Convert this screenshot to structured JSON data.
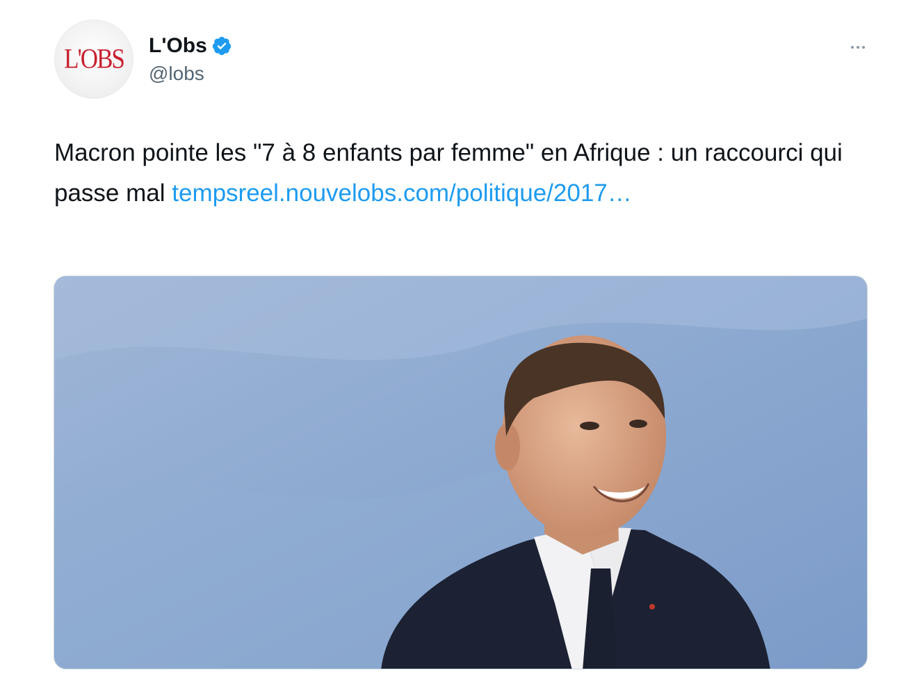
{
  "author": {
    "avatar_logo_text": "L'OBS",
    "display_name": "L'Obs",
    "handle": "@lobs",
    "verified": true
  },
  "tweet": {
    "text": "Macron pointe les \"7 à 8 enfants par femme\" en Afrique : un raccourci qui passe mal ",
    "link_text": "tempsreel.nouvelobs.com/politique/2017…"
  },
  "media": {
    "description": "photo"
  },
  "icons": {
    "verified": "verified-badge-icon",
    "more": "more-options-icon"
  },
  "colors": {
    "link": "#1d9bf0",
    "verified": "#1d9bf0",
    "handle": "#536471",
    "logo": "#c8202f"
  }
}
